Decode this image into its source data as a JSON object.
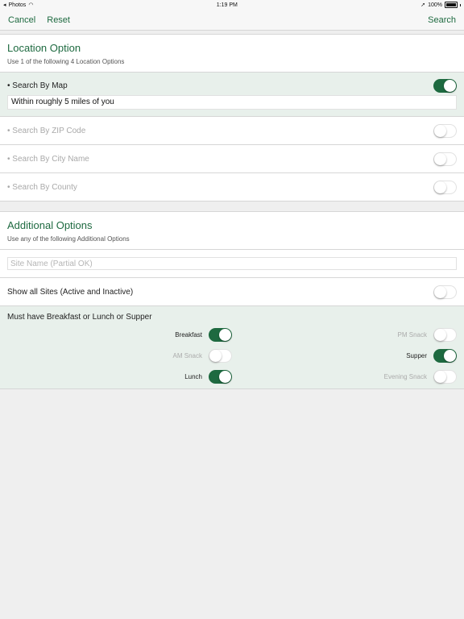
{
  "status_bar": {
    "app": "Photos",
    "time": "1:19 PM",
    "battery": "100%"
  },
  "navbar": {
    "cancel": "Cancel",
    "reset": "Reset",
    "search": "Search"
  },
  "location": {
    "title": "Location Option",
    "subtitle": "Use 1 of the following 4 Location Options",
    "map": {
      "label": "• Search By Map",
      "on": true,
      "value": "Within roughly 5 miles of you"
    },
    "options": [
      {
        "label": "• Search By ZIP Code",
        "on": false
      },
      {
        "label": "• Search By City Name",
        "on": false
      },
      {
        "label": "• Search By County",
        "on": false
      }
    ]
  },
  "additional": {
    "title": "Additional Options",
    "subtitle": "Use any of the following Additional Options",
    "site_name_placeholder": "Site Name (Partial OK)",
    "show_all_label": "Show all Sites (Active and Inactive)",
    "show_all_on": false
  },
  "meals": {
    "title": "Must have Breakfast or Lunch or Supper",
    "items": [
      {
        "label": "Breakfast",
        "on": true
      },
      {
        "label": "PM Snack",
        "on": false
      },
      {
        "label": "AM Snack",
        "on": false
      },
      {
        "label": "Supper",
        "on": true
      },
      {
        "label": "Lunch",
        "on": true
      },
      {
        "label": "Evening Snack",
        "on": false
      }
    ]
  },
  "colors": {
    "accent": "#1e6a40",
    "highlight": "#e8f0eb",
    "background": "#efefef"
  }
}
